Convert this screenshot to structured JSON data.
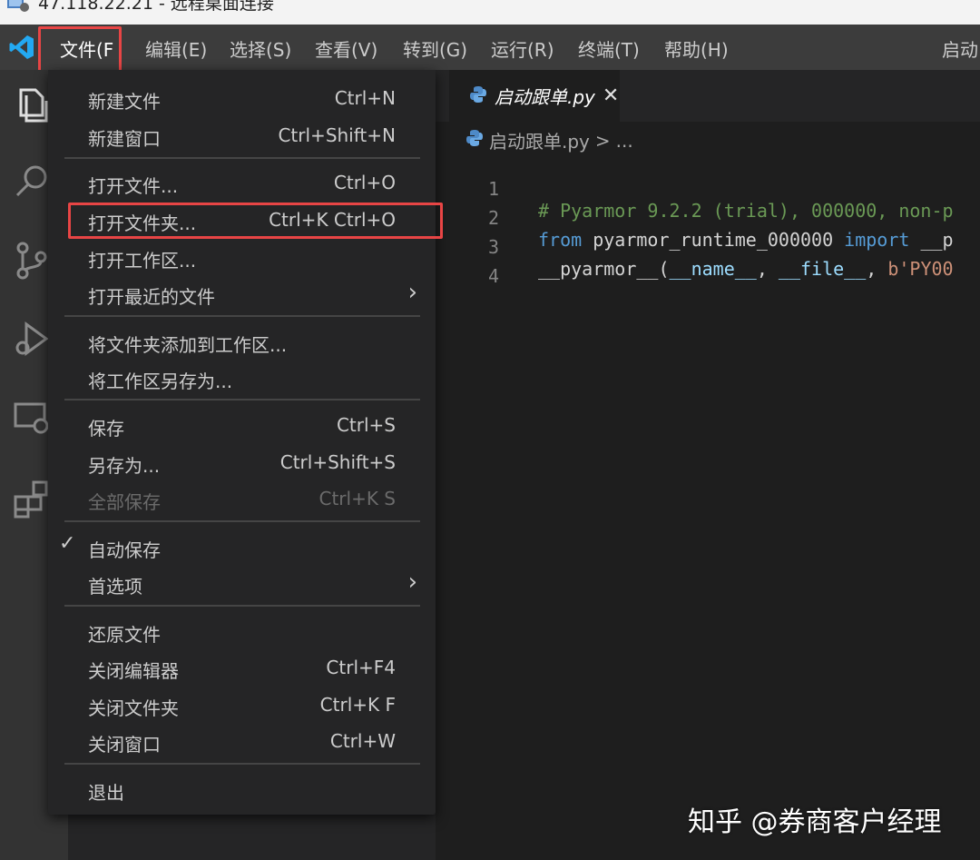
{
  "rdp": {
    "title": "47.118.22.21 - 远程桌面连接"
  },
  "menubar": {
    "items": [
      {
        "label": "文件(F"
      },
      {
        "label": "编辑(E)"
      },
      {
        "label": "选择(S)"
      },
      {
        "label": "查看(V)"
      },
      {
        "label": "转到(G)"
      },
      {
        "label": "运行(R)"
      },
      {
        "label": "终端(T)"
      },
      {
        "label": "帮助(H)"
      }
    ],
    "window_title": "启动"
  },
  "file_menu": {
    "items": [
      {
        "label": "新建文件",
        "shortcut": "Ctrl+N"
      },
      {
        "label": "新建窗口",
        "shortcut": "Ctrl+Shift+N"
      },
      {
        "label": "打开文件...",
        "shortcut": "Ctrl+O"
      },
      {
        "label": "打开文件夹...",
        "shortcut": "Ctrl+K Ctrl+O"
      },
      {
        "label": "打开工作区..."
      },
      {
        "label": "打开最近的文件"
      },
      {
        "label": "将文件夹添加到工作区..."
      },
      {
        "label": "将工作区另存为..."
      },
      {
        "label": "保存",
        "shortcut": "Ctrl+S"
      },
      {
        "label": "另存为...",
        "shortcut": "Ctrl+Shift+S"
      },
      {
        "label": "全部保存",
        "shortcut": "Ctrl+K S",
        "disabled": true
      },
      {
        "label": "自动保存",
        "checked": true
      },
      {
        "label": "首选项"
      },
      {
        "label": "还原文件"
      },
      {
        "label": "关闭编辑器",
        "shortcut": "Ctrl+F4"
      },
      {
        "label": "关闭文件夹",
        "shortcut": "Ctrl+K F"
      },
      {
        "label": "关闭窗口",
        "shortcut": "Ctrl+W"
      },
      {
        "label": "退出"
      }
    ]
  },
  "editor": {
    "tab": {
      "label": "启动跟单.py",
      "close": "✕"
    },
    "breadcrumb": {
      "file": "启动跟单.py",
      "sep": ">",
      "more": "..."
    },
    "lines": [
      {
        "num": "1",
        "comment": "# Pyarmor 9.2.2 (trial), 000000, non-p"
      },
      {
        "num": "2",
        "kw1": "from",
        "mod": " pyarmor_runtime_000000 ",
        "kw2": "import",
        "rest": " __p"
      },
      {
        "num": "3",
        "fn": "__pyarmor__",
        "p1": "(",
        "a1": "__name__",
        "p2": ", ",
        "a2": "__file__",
        "p3": ", ",
        "str": "b'PY00"
      },
      {
        "num": "4"
      }
    ]
  },
  "watermark": "知乎 @券商客户经理",
  "colors": {
    "highlight": "#e84545",
    "vscode_blue": "#23a9f2"
  }
}
